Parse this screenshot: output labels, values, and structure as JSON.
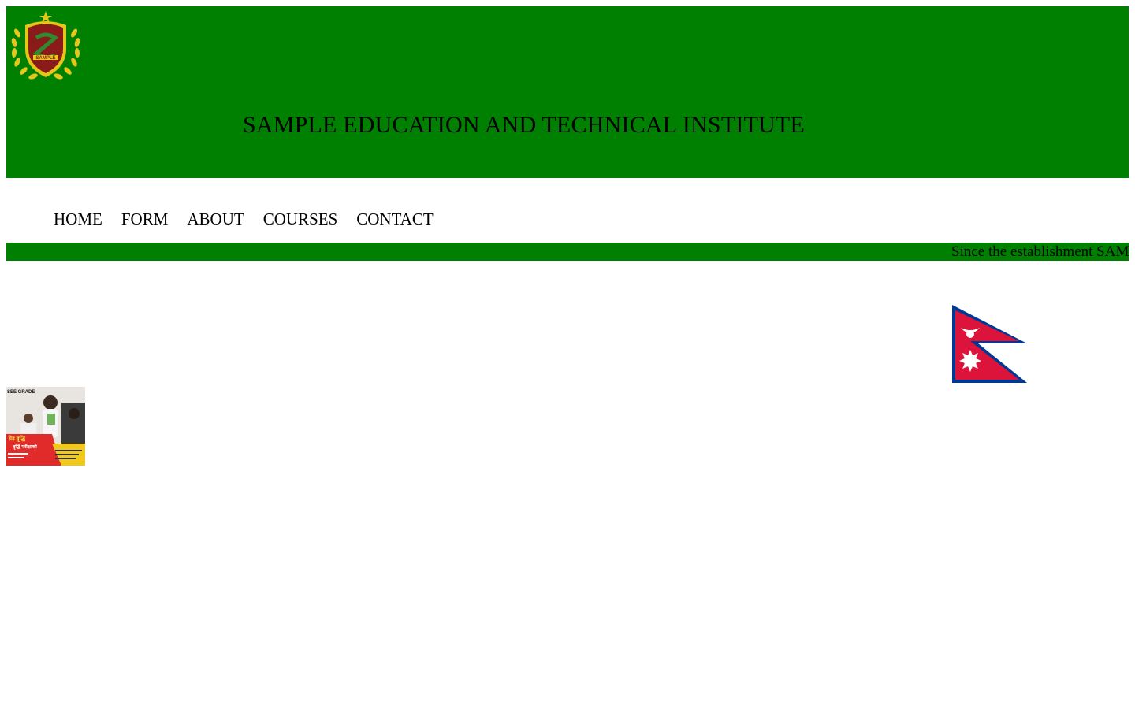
{
  "header": {
    "title": "SAMPLE EDUCATION AND TECHNICAL INSTITUTE",
    "logo_icon": "institute-logo-icon",
    "logo_text": "SAMPLE"
  },
  "nav": {
    "items": [
      {
        "label": "HOME"
      },
      {
        "label": "FORM"
      },
      {
        "label": "ABOUT"
      },
      {
        "label": "COURSES"
      },
      {
        "label": "CONTACT"
      }
    ]
  },
  "ticker": {
    "text": "Since the establishment SAM"
  },
  "flag": {
    "icon": "nepal-flag-icon"
  },
  "promo": {
    "heading": "SEE GRADE",
    "subheading": "वृद्धि परीक्षाको",
    "banner_text": "ग्रेड वृद्धि"
  },
  "colors": {
    "header_bg": "#008000",
    "ticker_bg": "#008000",
    "flag_red": "#DC143C",
    "flag_blue": "#003893"
  }
}
